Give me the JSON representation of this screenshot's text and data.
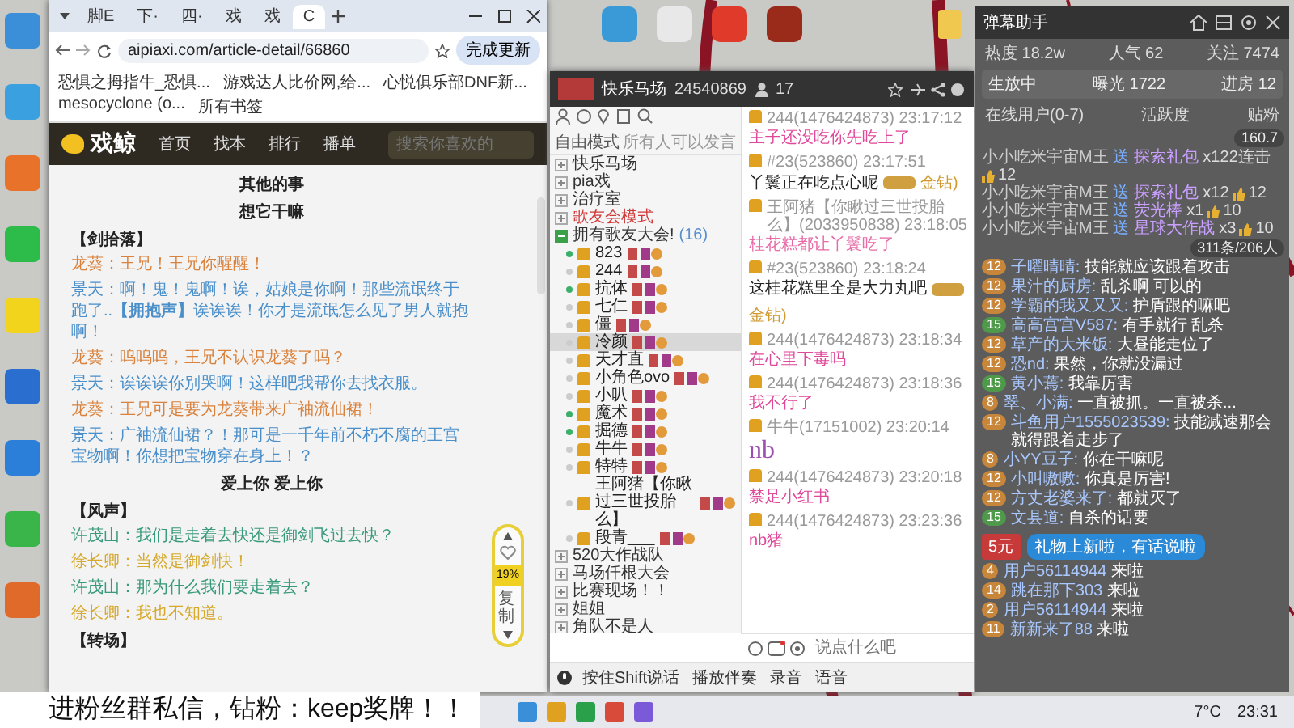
{
  "browser": {
    "tabs": [
      {
        "label": "脚E",
        "selected": false
      },
      {
        "label": "下·",
        "selected": false
      },
      {
        "label": "四·",
        "selected": false
      },
      {
        "label": "戏",
        "selected": false
      },
      {
        "label": "戏",
        "selected": false
      },
      {
        "label": "C",
        "selected": true
      }
    ],
    "address": "aipiaxi.com/article-detail/66860",
    "update_button": "完成更新",
    "bookmarks": [
      "恐惧之拇指牛_恐惧...",
      "游戏达人比价网,给...",
      "心悦俱乐部DNF新...",
      "mesocyclone (o..."
    ],
    "all_bookmarks": "所有书签",
    "site": {
      "logo": "戏鲸",
      "nav": [
        "首页",
        "找本",
        "排行",
        "播单"
      ],
      "search_placeholder": "搜索你喜欢的"
    },
    "article": [
      {
        "kind": "heading",
        "text": "其他的事"
      },
      {
        "kind": "heading",
        "text": "想它干嘛"
      },
      {
        "kind": "tag",
        "text": "【剑拾落】"
      },
      {
        "kind": "line",
        "text": "龙葵：王兄！王兄你醒醒！",
        "color": "#d9823e"
      },
      {
        "kind": "line",
        "text": "景天：啊！鬼！鬼啊！诶，姑娘是你啊！那些流氓终于跑了..**【拥抱声】**诶诶诶！你才是流氓怎么见了男人就抱啊！",
        "color": "#4a8fca"
      },
      {
        "kind": "line",
        "text": "龙葵：呜呜呜，王兄不认识龙葵了吗？",
        "color": "#d9823e"
      },
      {
        "kind": "line",
        "text": "景天：诶诶诶你别哭啊！这样吧我帮你去找衣服。",
        "color": "#4a8fca"
      },
      {
        "kind": "line",
        "text": "龙葵：王兄可是要为龙葵带来广袖流仙裙！",
        "color": "#d9823e"
      },
      {
        "kind": "line",
        "text": "景天：广袖流仙裙？！那可是一千年前不朽不腐的王宫宝物啊！你想把宝物穿在身上！？",
        "color": "#4a8fca"
      },
      {
        "kind": "heading",
        "text": "爱上你 爱上你"
      },
      {
        "kind": "tag",
        "text": "【风声】"
      },
      {
        "kind": "line",
        "text": "许茂山：我们是走着去快还是御剑飞过去快？",
        "color": "#3a9a7c"
      },
      {
        "kind": "line",
        "text": "徐长卿：当然是御剑快！",
        "color": "#d6a92c"
      },
      {
        "kind": "line",
        "text": "许茂山：那为什么我们要走着去？",
        "color": "#3a9a7c"
      },
      {
        "kind": "line",
        "text": "徐长卿：我也不知道。",
        "color": "#d6a92c"
      },
      {
        "kind": "tag",
        "text": "【转场】"
      }
    ],
    "reader": {
      "progress": "19%",
      "copy": "复制"
    }
  },
  "chat_app": {
    "room": "快乐马场",
    "room_id": "24540869",
    "members_count": "17",
    "mode": "自由模式",
    "mode_note": "所有人可以发言",
    "channels": [
      {
        "name": "快乐马场",
        "expanded": false,
        "highlight": false
      },
      {
        "name": "pia戏",
        "expanded": false,
        "highlight": false
      },
      {
        "name": "治疗室",
        "expanded": false,
        "highlight": false
      },
      {
        "name": "歌友会模式",
        "expanded": false,
        "highlight": true
      },
      {
        "name": "拥有歌友大会!",
        "count": "(16)",
        "expanded": true,
        "highlight": false,
        "members": [
          {
            "name": "823",
            "online": true,
            "selected": false
          },
          {
            "name": "244",
            "online": false,
            "selected": false
          },
          {
            "name": "抗体",
            "online": true,
            "selected": false
          },
          {
            "name": "七仁",
            "online": false,
            "selected": false
          },
          {
            "name": "僵",
            "online": false,
            "selected": false
          },
          {
            "name": "冷颜",
            "online": false,
            "selected": true
          },
          {
            "name": "天才直",
            "online": false,
            "selected": false
          },
          {
            "name": "小角色ovo",
            "online": false,
            "selected": false
          },
          {
            "name": "小叭",
            "online": false,
            "selected": false
          },
          {
            "name": "魔术",
            "online": true,
            "selected": false
          },
          {
            "name": "掘德",
            "online": true,
            "selected": false
          },
          {
            "name": "牛牛",
            "online": false,
            "selected": false
          },
          {
            "name": "特特",
            "online": false,
            "selected": false
          },
          {
            "name": "王阿猪【你瞅过三世投胎么】",
            "online": false,
            "selected": false
          },
          {
            "name": "段青___",
            "online": false,
            "selected": false
          }
        ]
      },
      {
        "name": "520大作战队",
        "expanded": false,
        "highlight": false
      },
      {
        "name": "马场仟根大会",
        "expanded": false,
        "highlight": false
      },
      {
        "name": "比赛现场！！",
        "expanded": false,
        "highlight": false
      },
      {
        "name": "姐姐",
        "expanded": false,
        "highlight": false
      },
      {
        "name": "角队不是人",
        "expanded": false,
        "highlight": false
      }
    ],
    "messages": [
      {
        "kind": "text",
        "meta": "244(1476424873) 23:17:12",
        "text": "主子还没吃你先吃上了",
        "color": "#e0489a"
      },
      {
        "kind": "gift",
        "meta": "#23(523860) 23:17:51",
        "text": "丫鬟正在吃点心呢",
        "gift_label": "金钻)",
        "color": "#222222"
      },
      {
        "kind": "text",
        "meta": "王阿猪【你瞅过三世投胎么】(2033950838) 23:18:05",
        "text": "桂花糕都让丫鬟吃了",
        "color": "#e66aa6"
      },
      {
        "kind": "gift",
        "meta": "#23(523860) 23:18:24",
        "text": "这桂花糕里全是大力丸吧",
        "gift_label": "金钻)",
        "color": "#222222"
      },
      {
        "kind": "text",
        "meta": "244(1476424873) 23:18:34",
        "text": "在心里下毒吗",
        "color": "#e0489a"
      },
      {
        "kind": "text",
        "meta": "244(1476424873) 23:18:36",
        "text": "我不行了",
        "color": "#e0489a"
      },
      {
        "kind": "big",
        "meta": "牛牛(17151002) 23:20:14",
        "text": "nb",
        "color": "#9a4fb0"
      },
      {
        "kind": "text",
        "meta": "244(1476424873) 23:20:18",
        "text": "禁足小红书",
        "color": "#e0489a"
      },
      {
        "kind": "text",
        "meta": "244(1476424873) 23:23:36",
        "text": "nb猪",
        "color": "#e0489a"
      }
    ],
    "input_placeholder": "说点什么吧",
    "toolbar": [
      "按住Shift说话",
      "播放伴奏",
      "录音",
      "语音"
    ]
  },
  "assistant": {
    "title": "弹幕助手",
    "stats": [
      {
        "label": "热度",
        "value": "18.2w"
      },
      {
        "label": "人气",
        "value": "62"
      },
      {
        "label": "关注",
        "value": "7474"
      }
    ],
    "live": {
      "status": "生放中",
      "exposure": "曝光 1722",
      "entries": "进房 12"
    },
    "tabs": [
      "在线用户(0-7)",
      "活跃度",
      "贴粉"
    ],
    "gifts_badge": "160.7",
    "gifts": [
      {
        "user": "小小吃米宇宙M王",
        "action": "送",
        "gift": "探索礼包",
        "count": "x12",
        "combo": "2连击",
        "likes": "12"
      },
      {
        "user": "小小吃米宇宙M王",
        "action": "送",
        "gift": "探索礼包",
        "count": "x12",
        "likes": "12"
      },
      {
        "user": "小小吃米宇宙M王",
        "action": "送",
        "gift": "荧光棒",
        "count": "x1",
        "likes": "10"
      },
      {
        "user": "小小吃米宇宙M王",
        "action": "送",
        "gift": "星球大作战",
        "count": "x3",
        "likes": "10"
      }
    ],
    "chat_badge": "311条/206人",
    "chats": [
      {
        "level": "12",
        "color": "#c8863a",
        "user": "子曜晴晴:",
        "text": "技能就应该跟着攻击"
      },
      {
        "level": "12",
        "color": "#c8863a",
        "user": "果汁的厨房:",
        "text": "乱杀啊 可以的"
      },
      {
        "level": "12",
        "color": "#c8863a",
        "user": "学霸的我又又又:",
        "text": "护盾跟的嘛吧"
      },
      {
        "level": "15",
        "color": "#4e9a4a",
        "user": "高高宫宫V587:",
        "text": "有手就行 乱杀"
      },
      {
        "level": "12",
        "color": "#c8863a",
        "user": "草产的大米饭:",
        "text": "大昼能走位了"
      },
      {
        "level": "12",
        "color": "#c8863a",
        "user": "恐nd:",
        "text": "果然，你就没漏过"
      },
      {
        "level": "15",
        "color": "#4e9a4a",
        "user": "黄小蔫:",
        "text": "我靠厉害"
      },
      {
        "level": "8",
        "color": "#c8863a",
        "user": "翠、小满:",
        "text": "一直被抓。一直被杀..."
      },
      {
        "level": "12",
        "color": "#c8863a",
        "user": "斗鱼用户1555023539:",
        "text": "技能减速那会就得跟着走步了"
      },
      {
        "level": "8",
        "color": "#c8863a",
        "user": "小YY豆子:",
        "text": "你在干嘛呢"
      },
      {
        "level": "12",
        "color": "#c8863a",
        "user": "小叫嗷嗷:",
        "text": "你真是厉害!"
      },
      {
        "level": "12",
        "color": "#c8863a",
        "user": "方丈老婆来了:",
        "text": "都就灭了"
      },
      {
        "level": "15",
        "color": "#4e9a4a",
        "user": "文县道:",
        "text": "自杀的话要"
      }
    ],
    "stamp": "5元",
    "tooltip": "礼物上新啦，有话说啦",
    "entries": [
      {
        "level": "4",
        "user": "用户56114944",
        "text": "来啦"
      },
      {
        "level": "14",
        "user": "跳在那下303",
        "text": "来啦"
      },
      {
        "level": "2",
        "user": "用户56114944",
        "text": "来啦"
      },
      {
        "level": "11",
        "user": "新新来了88",
        "text": "来啦"
      }
    ]
  },
  "caption": "进粉丝群私信，钻粉：keep奖牌！！",
  "taskbar": {
    "weather": "7°C",
    "clock": "23:31"
  }
}
